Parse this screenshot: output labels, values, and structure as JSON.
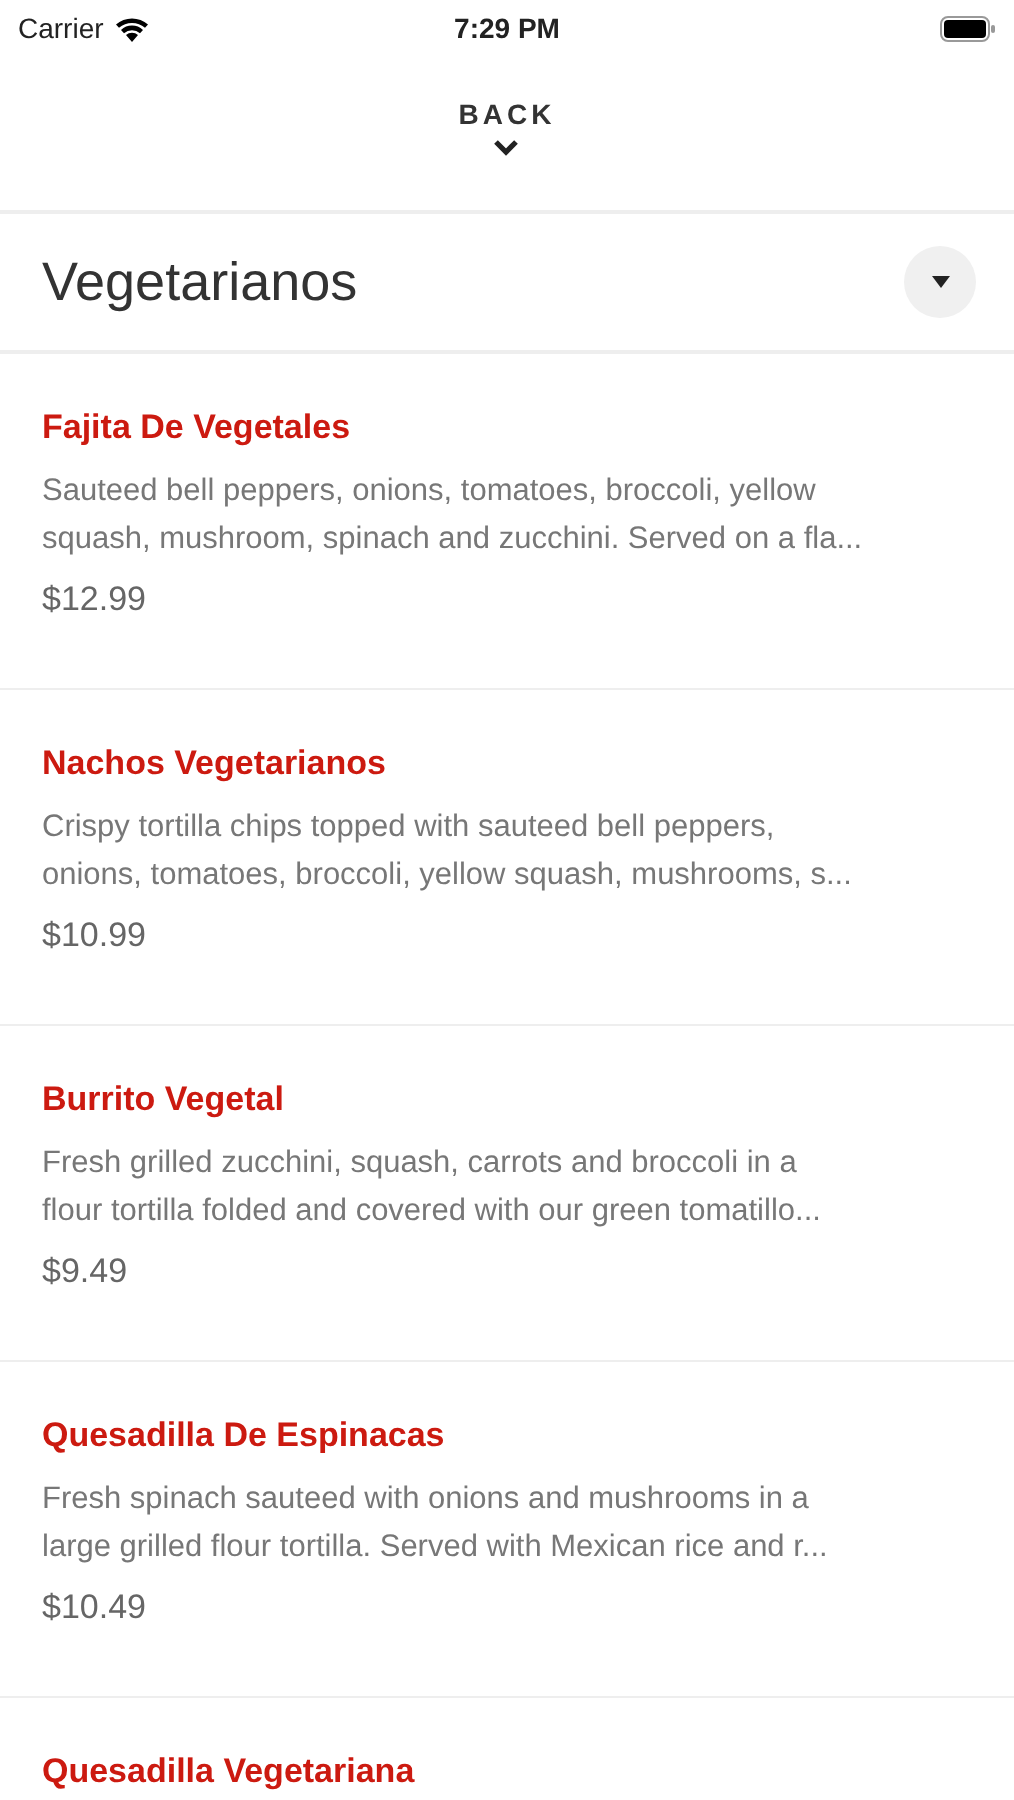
{
  "status_bar": {
    "carrier": "Carrier",
    "time": "7:29 PM"
  },
  "nav": {
    "back": "BACK"
  },
  "category": {
    "title": "Vegetarianos",
    "expanded": true
  },
  "items": [
    {
      "name": "Fajita De Vegetales",
      "description": [
        "Sauteed bell peppers, onions, tomatoes, broccoli, yellow",
        "squash, mushroom, spinach and zucchini. Served on a fla..."
      ],
      "price": "$12.99"
    },
    {
      "name": "Nachos Vegetarianos",
      "description": [
        "Crispy tortilla chips topped with sauteed bell peppers,",
        "onions, tomatoes, broccoli, yellow squash, mushrooms, s..."
      ],
      "price": "$10.99"
    },
    {
      "name": "Burrito Vegetal",
      "description": [
        "Fresh grilled zucchini, squash, carrots and broccoli in a",
        "flour tortilla folded and covered with our green tomatillo..."
      ],
      "price": "$9.49"
    },
    {
      "name": "Quesadilla De Espinacas",
      "description": [
        "Fresh spinach sauteed with onions and mushrooms in a",
        "large grilled flour tortilla. Served with Mexican rice and r..."
      ],
      "price": "$10.49"
    },
    {
      "name": "Quesadilla Vegetariana"
    }
  ]
}
